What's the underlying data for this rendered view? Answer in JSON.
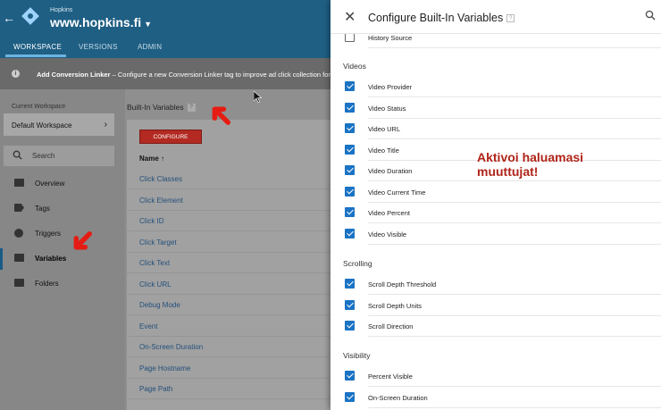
{
  "header": {
    "account": "Hopkins",
    "container": "www.hopkins.fi"
  },
  "tabs": [
    {
      "label": "WORKSPACE",
      "active": true
    },
    {
      "label": "VERSIONS",
      "active": false
    },
    {
      "label": "ADMIN",
      "active": false
    }
  ],
  "notice": {
    "title": "Add Conversion Linker",
    "text": "– Configure a new Conversion Linker tag to improve ad click collection for"
  },
  "sidebar": {
    "current_workspace_label": "Current Workspace",
    "workspace_name": "Default Workspace",
    "search_placeholder": "Search",
    "items": [
      {
        "label": "Overview",
        "icon": "overview-icon"
      },
      {
        "label": "Tags",
        "icon": "tag-icon"
      },
      {
        "label": "Triggers",
        "icon": "trigger-icon"
      },
      {
        "label": "Variables",
        "icon": "variables-icon",
        "active": true
      },
      {
        "label": "Folders",
        "icon": "folder-icon"
      }
    ]
  },
  "main": {
    "title": "Built-In Variables",
    "configure_label": "CONFIGURE",
    "column_name": "Name",
    "rows": [
      "Click Classes",
      "Click Element",
      "Click ID",
      "Click Target",
      "Click Text",
      "Click URL",
      "Debug Mode",
      "Event",
      "On-Screen Duration",
      "Page Hostname",
      "Page Path"
    ]
  },
  "drawer": {
    "title": "Configure Built-In Variables",
    "top_item": {
      "label": "History Source",
      "checked": false
    },
    "sections": [
      {
        "title": "Videos",
        "items": [
          {
            "label": "Video Provider",
            "checked": true
          },
          {
            "label": "Video Status",
            "checked": true
          },
          {
            "label": "Video URL",
            "checked": true
          },
          {
            "label": "Video Title",
            "checked": true
          },
          {
            "label": "Video Duration",
            "checked": true
          },
          {
            "label": "Video Current Time",
            "checked": true
          },
          {
            "label": "Video Percent",
            "checked": true
          },
          {
            "label": "Video Visible",
            "checked": true
          }
        ]
      },
      {
        "title": "Scrolling",
        "items": [
          {
            "label": "Scroll Depth Threshold",
            "checked": true
          },
          {
            "label": "Scroll Depth Units",
            "checked": true
          },
          {
            "label": "Scroll Direction",
            "checked": true
          }
        ]
      },
      {
        "title": "Visibility",
        "items": [
          {
            "label": "Percent Visible",
            "checked": true
          },
          {
            "label": "On-Screen Duration",
            "checked": true
          }
        ]
      }
    ]
  },
  "annotation": {
    "line1": "Aktivoi haluamasi",
    "line2": "muuttujat!"
  },
  "colors": {
    "brand": "#1f5f84",
    "checkbox": "#1a73c4",
    "configure_button": "#b22a22",
    "annotation": "#b02418",
    "arrow": "#e51c13"
  }
}
